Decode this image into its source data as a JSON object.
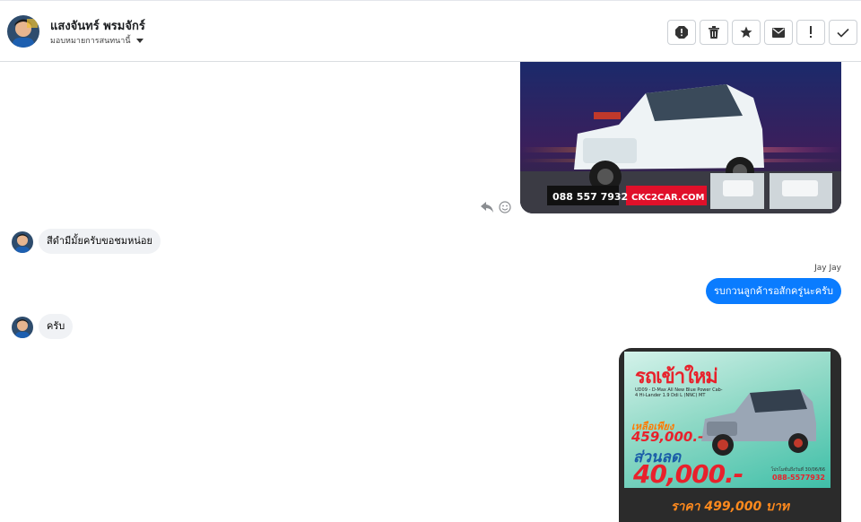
{
  "header": {
    "contact_name": "แสงจันทร์ พรมจักร์",
    "assign_label": "มอบหมายการสนทนานี้",
    "actions": [
      {
        "name": "report-spam-icon",
        "label": "Report"
      },
      {
        "name": "trash-icon",
        "label": "Delete"
      },
      {
        "name": "star-icon",
        "label": "Star"
      },
      {
        "name": "envelope-icon",
        "label": "Mark as unread"
      },
      {
        "name": "exclamation-icon",
        "label": "Follow up"
      },
      {
        "name": "check-icon",
        "label": "Done"
      }
    ]
  },
  "messages": {
    "car_ad_1": {
      "phone": "088 557 7932",
      "site": "CKC2CAR.COM"
    },
    "incoming_1": "สีดำมีมั้ยครับขอชมหน่อย",
    "outgoing_sender": "Jay Jay",
    "outgoing_1": "รบกวนลูกค้ารอสักครู่นะครับ",
    "incoming_2": "ครับ",
    "car_ad_2": {
      "title": "รถเข้าใหม่",
      "model_text": "UD09 - D-Max All New Blue Power Cab-4 Hi-Lander 1.9 Ddi L (NNC) MT",
      "remain_label": "เหลือเพียง",
      "price_now": "459,000.-",
      "discount_label": "ส่วนลด",
      "discount_value": "40,000.-",
      "valid_date": "โปรโมชั่นถึงวันที่ 30/06/66",
      "phone": "088-5577932",
      "footer_price": "ราคา 499,000 บาท"
    }
  },
  "colors": {
    "outgoing_bubble": "#0a7cff",
    "incoming_bubble": "#f0f2f5"
  }
}
